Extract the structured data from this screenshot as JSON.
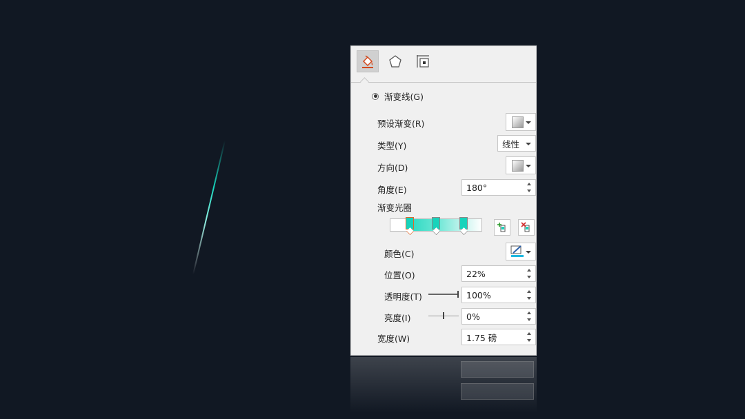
{
  "tabs": [
    {
      "icon": "fill-bucket-icon",
      "active": true
    },
    {
      "icon": "pentagon-shape-icon",
      "active": false
    },
    {
      "icon": "size-layout-icon",
      "active": false
    }
  ],
  "line_option": {
    "label": "渐变线(G)"
  },
  "preset_gradient": {
    "label": "预设渐变(R)"
  },
  "type": {
    "label": "类型(Y)",
    "value": "线性"
  },
  "direction": {
    "label": "方向(D)"
  },
  "angle": {
    "label": "角度(E)",
    "value": "180°"
  },
  "gradient_stops": {
    "label": "渐变光圈",
    "stops_positions_pct": [
      22,
      50,
      80
    ],
    "selected_index": 0,
    "colors": [
      "#17d3bb",
      "#17d3bb",
      "#17d3bb"
    ]
  },
  "color": {
    "label": "颜色(C)",
    "value_color": "#1fb8e0"
  },
  "position": {
    "label": "位置(O)",
    "value": "22%"
  },
  "transparency": {
    "label": "透明度(T)",
    "value": "100%",
    "level": 1.0
  },
  "brightness": {
    "label": "亮度(I)",
    "value": "0%",
    "level": 0.5
  },
  "width": {
    "label": "宽度(W)",
    "value": "1.75 磅"
  },
  "colors": {
    "background": "#111823",
    "accent": "#17d3bb",
    "panel": "#f0f0f0",
    "selected_stop_border": "#e2682b"
  }
}
